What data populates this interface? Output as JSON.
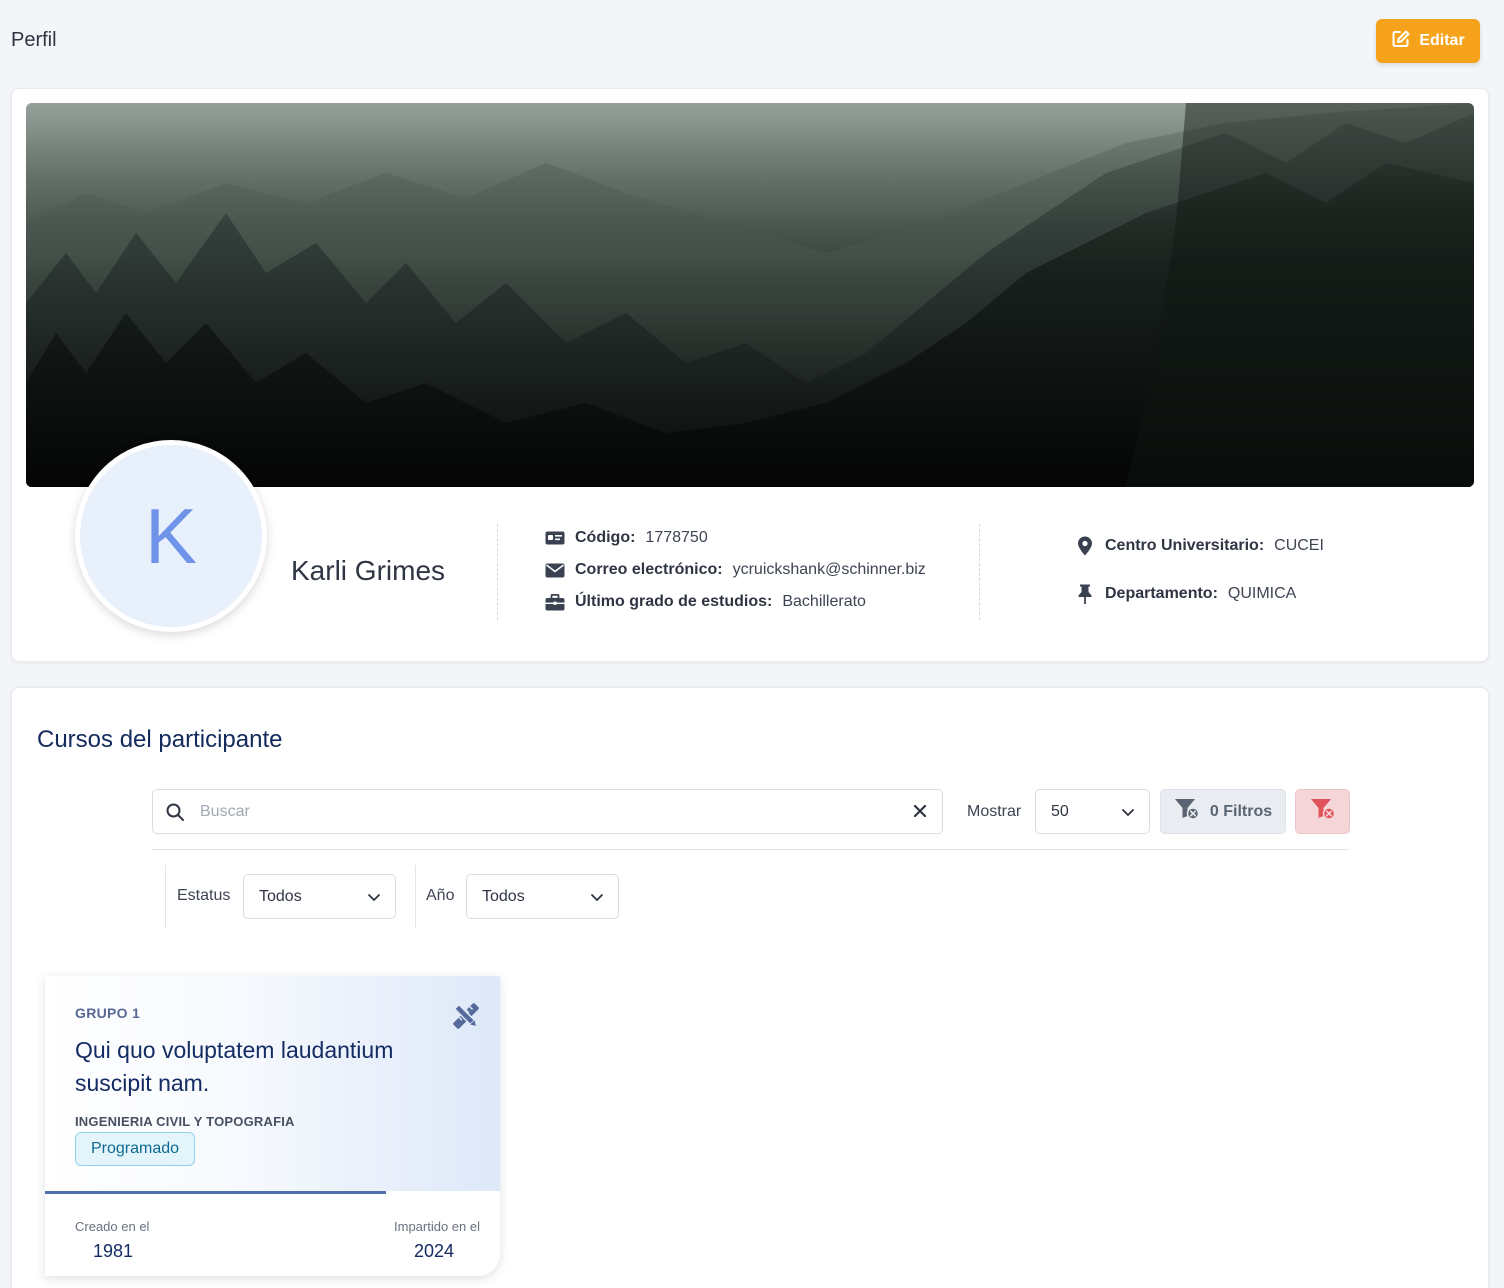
{
  "header": {
    "title": "Perfil",
    "edit_label": "Editar"
  },
  "profile": {
    "avatar_initial": "K",
    "name": "Karli Grimes",
    "code": {
      "label": "Código:",
      "value": "1778750"
    },
    "email": {
      "label": "Correo electrónico:",
      "value": "ycruickshank@schinner.biz"
    },
    "degree": {
      "label": "Último grado de estudios:",
      "value": "Bachillerato"
    },
    "center": {
      "label": "Centro Universitario:",
      "value": "CUCEI"
    },
    "department": {
      "label": "Departamento:",
      "value": "QUIMICA"
    }
  },
  "courses_section": {
    "title": "Cursos del participante",
    "search_placeholder": "Buscar",
    "show_label": "Mostrar",
    "show_value": "50",
    "filters_label": "0 Filtros",
    "status_label": "Estatus",
    "status_value": "Todos",
    "year_label": "Año",
    "year_value": "Todos"
  },
  "courses": [
    {
      "group": "GRUPO 1",
      "title": "Qui quo voluptatem laudantium suscipit nam.",
      "department": "INGENIERIA CIVIL Y TOPOGRAFIA",
      "status": "Programado",
      "created_label": "Creado en el",
      "created_value": "1981",
      "taught_label": "Impartido en el",
      "taught_value": "2024",
      "progress": 0.75
    }
  ],
  "colors": {
    "accent": "#f7a21b",
    "title_blue": "#122a5c",
    "badge_text": "#0e6a91",
    "danger_soft": "#f5d6d8",
    "avatar_bg": "#e8f0fc"
  },
  "icons": {
    "edit": "edit-icon",
    "code": "id-card-icon",
    "email": "envelope-icon",
    "degree": "briefcase-icon",
    "center": "map-pin-icon",
    "department": "thumbtack-icon",
    "search": "search-icon",
    "clear": "close-icon",
    "filter": "filter-icon",
    "clear_filters": "filter-clear-icon",
    "course_edit": "pencil-ruler-icon"
  }
}
